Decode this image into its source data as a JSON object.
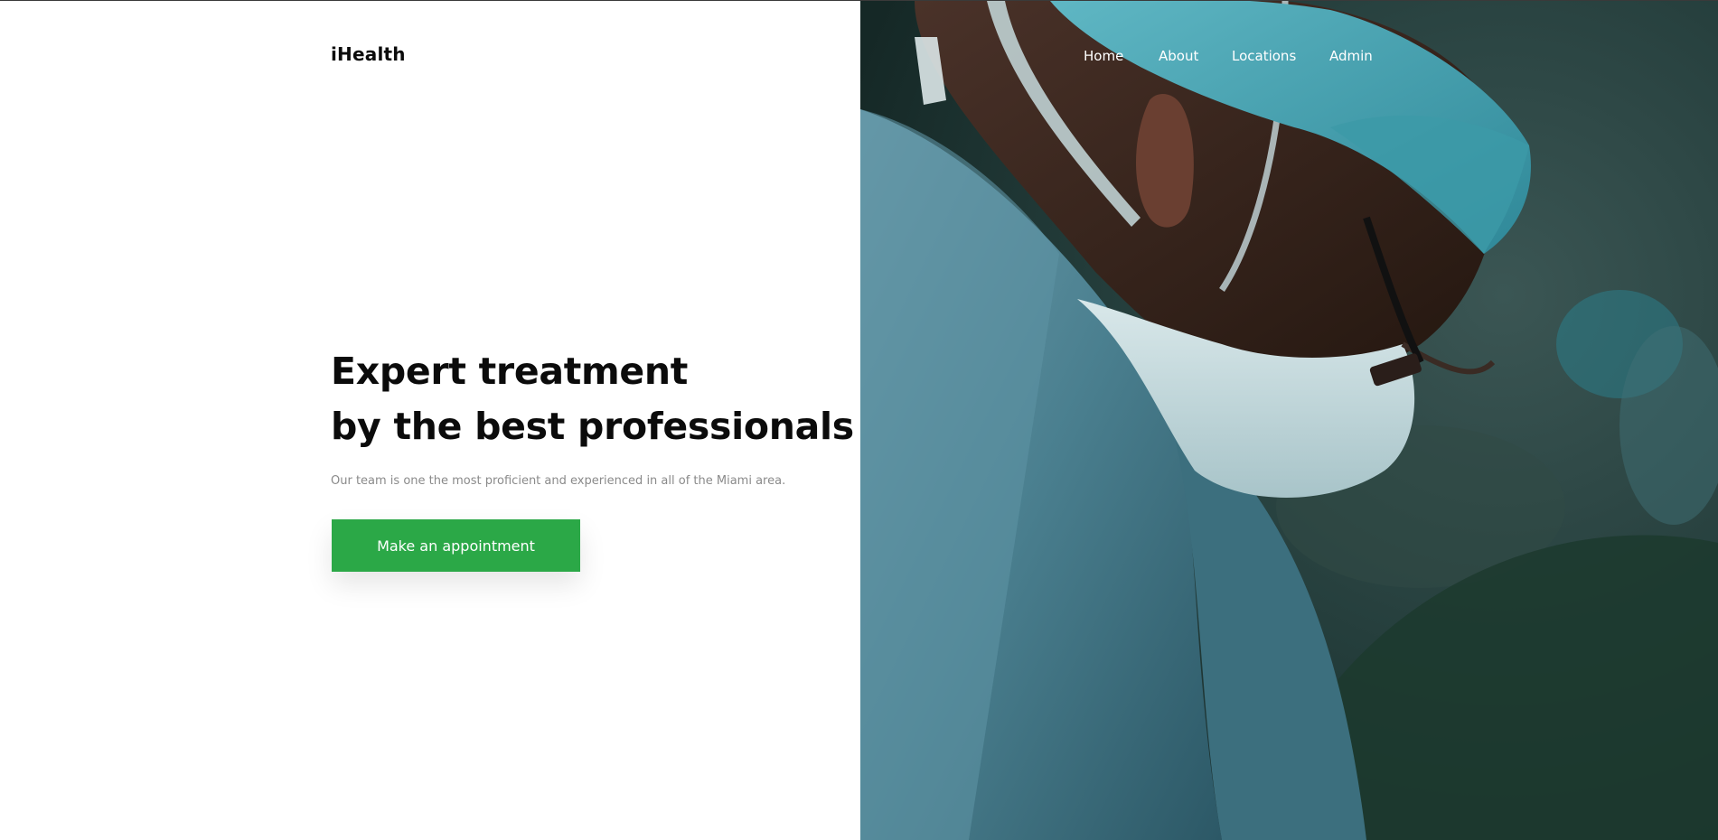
{
  "brand": {
    "name": "iHealth"
  },
  "nav": {
    "items": [
      {
        "label": "Home"
      },
      {
        "label": "About"
      },
      {
        "label": "Locations"
      },
      {
        "label": "Admin"
      }
    ]
  },
  "hero": {
    "title_line1": "Expert treatment",
    "title_line2": "by the best professionals",
    "subtitle": "Our team is one the most proficient and experienced in all of the Miami area.",
    "cta_label": "Make an appointment"
  },
  "colors": {
    "accent": "#2ba847",
    "text_primary": "#0b0b0b",
    "text_muted": "#8a8a8a"
  }
}
